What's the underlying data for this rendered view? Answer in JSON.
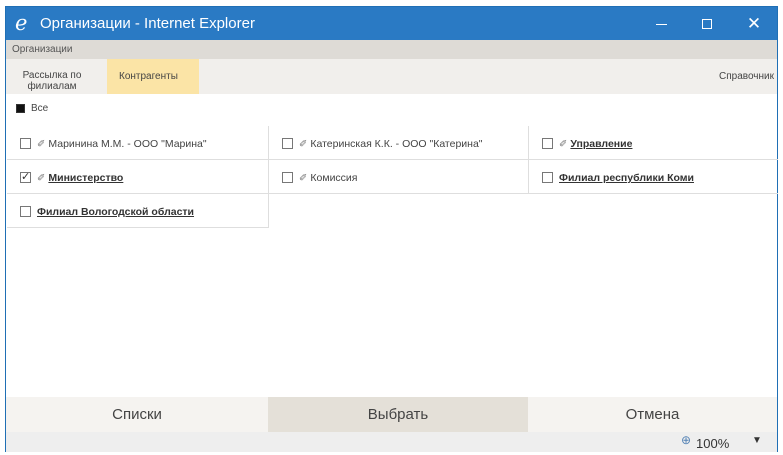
{
  "window": {
    "ie_icon": "e",
    "title": "Организации - Internet Explorer",
    "minimize_icon": "minimize-icon",
    "maximize_icon": "maximize-icon",
    "close_glyph": "✕"
  },
  "header": {
    "label": "Организации"
  },
  "tabs": [
    {
      "label": "Рассылка по филиалам",
      "active": false
    },
    {
      "label": "Контрагенты",
      "active": true
    },
    {
      "label": "Справочник",
      "active": false
    }
  ],
  "select_all": {
    "label": "Все",
    "state": "indeterminate"
  },
  "items": [
    {
      "label": "Маринина М.М. - ООО \"Марина\"",
      "checked": false,
      "clip": true,
      "bold": false
    },
    {
      "label": "Катеринская К.К. - ООО \"Катерина\"",
      "checked": false,
      "clip": true,
      "bold": false
    },
    {
      "label": "Управление",
      "checked": false,
      "clip": true,
      "bold": true
    },
    {
      "label": "Министерство",
      "checked": true,
      "clip": true,
      "bold": true
    },
    {
      "label": "Комиссия",
      "checked": false,
      "clip": true,
      "bold": false
    },
    {
      "label": "Филиал республики Коми",
      "checked": false,
      "clip": false,
      "bold": true
    },
    {
      "label": "Филиал Вологодской области",
      "checked": false,
      "clip": false,
      "bold": true
    }
  ],
  "buttons": {
    "lists": "Списки",
    "select": "Выбрать",
    "cancel": "Отмена"
  },
  "status": {
    "zoom": "100%",
    "zoom_icon": "zoom-in-icon",
    "dropdown_glyph": "▼"
  },
  "colors": {
    "titlebar": "#2a7ac4",
    "active_tab": "#fbe4a6"
  }
}
